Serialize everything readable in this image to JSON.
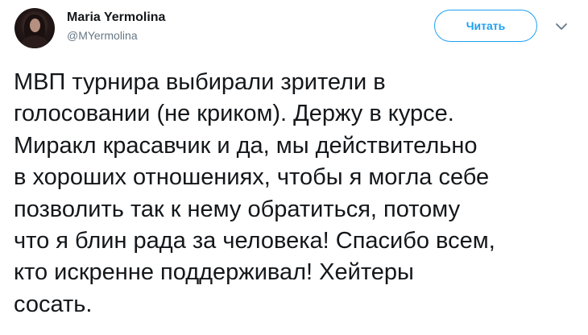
{
  "author": {
    "name": "Maria Yermolina",
    "handle": "@MYermolina"
  },
  "follow_button": {
    "label": "Читать"
  },
  "icons": {
    "avatar": "user-avatar-photo",
    "menu": "chevron-down-icon"
  },
  "colors": {
    "accent": "#1da1f2",
    "text": "#14171a",
    "secondary_text": "#657786"
  },
  "tweet": {
    "lines": [
      "МВП турнира выбирали зрители в",
      "голосовании (не криком). Держу в курсе.",
      "Миракл красавчик и да, мы действительно",
      "в хороших отношениях, чтобы я могла себе",
      "позволить так к нему обратиться, потому",
      "что я блин рада за человека! Спасибо всем,",
      "кто искренне поддерживал! Хейтеры",
      "сосать."
    ]
  }
}
